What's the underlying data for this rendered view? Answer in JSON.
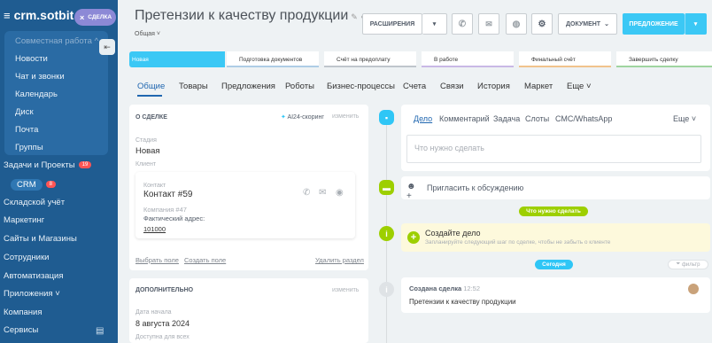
{
  "sidebar": {
    "logo": "crm.sotbit",
    "close_deal": "СДЕЛКА",
    "items": [
      {
        "label": "Совместная работа ^"
      },
      {
        "label": "Новости"
      },
      {
        "label": "Чат и звонки"
      },
      {
        "label": "Календарь"
      },
      {
        "label": "Диск"
      },
      {
        "label": "Почта"
      },
      {
        "label": "Группы"
      },
      {
        "label": "Задачи и Проекты",
        "badge": "19"
      },
      {
        "label": "CRM",
        "badge": "8"
      },
      {
        "label": "Складской учёт"
      },
      {
        "label": "Маркетинг"
      },
      {
        "label": "Сайты и Магазины"
      },
      {
        "label": "Сотрудники"
      },
      {
        "label": "Автоматизация"
      },
      {
        "label": "Приложения ˅"
      },
      {
        "label": "Компания"
      },
      {
        "label": "Сервисы"
      }
    ]
  },
  "header": {
    "title": "Претензии к качеству продукции",
    "category": "Общая ˅",
    "extensions": "РАСШИРЕНИЯ",
    "document": "ДОКУМЕНТ",
    "offer": "ПРЕДЛОЖЕНИЕ"
  },
  "stages": [
    {
      "label": "Новая",
      "color": "#3bc8f5",
      "active": true
    },
    {
      "label": "Подготовка документов",
      "color": "#aecde6"
    },
    {
      "label": "Счёт на предоплату",
      "color": "#bfc6cc"
    },
    {
      "label": "В работе",
      "color": "#c9b8e6"
    },
    {
      "label": "Финальный счёт",
      "color": "#f1c38c"
    },
    {
      "label": "Завершить сделку",
      "color": "#9fd5a0"
    }
  ],
  "tabs": [
    "Общие",
    "Товары",
    "Предложения",
    "Роботы",
    "Бизнес-процессы",
    "Счета",
    "Связи",
    "История",
    "Маркет",
    "Еще ˅"
  ],
  "deal": {
    "section_title": "О СДЕЛКЕ",
    "scoring": "AI24-скоринг",
    "edit": "изменить",
    "stage_label": "Стадия",
    "stage_value": "Новая",
    "client_label": "Клиент",
    "contact_label": "Контакт",
    "contact_name": "Контакт #59",
    "company": "Компания #47",
    "address_label": "Фактический адрес:",
    "address_value": "101000",
    "choose_field": "Выбрать поле",
    "create_field": "Создать поле",
    "delete_section": "Удалить раздел"
  },
  "extra": {
    "section_title": "ДОПОЛНИТЕЛЬНО",
    "edit": "изменить",
    "start_label": "Дата начала",
    "start_value": "8 августа 2024",
    "available_label": "Доступна для всех"
  },
  "activity": {
    "tabs": [
      "Дело",
      "Комментарий",
      "Задача",
      "Слоты",
      "СМС/WhatsApp"
    ],
    "more": "Еще ˅",
    "placeholder": "Что нужно сделать",
    "invite": "Пригласить к обсуждению",
    "todo_pill": "Что нужно сделать",
    "create_title": "Создайте дело",
    "create_sub": "Запланируйте следующий шаг по сделке, чтобы не забыть о клиенте",
    "today_pill": "Сегодня",
    "filter": "фильтр",
    "created_title": "Создана сделка",
    "created_time": "12:52",
    "created_text": "Претензии к качеству продукции"
  }
}
